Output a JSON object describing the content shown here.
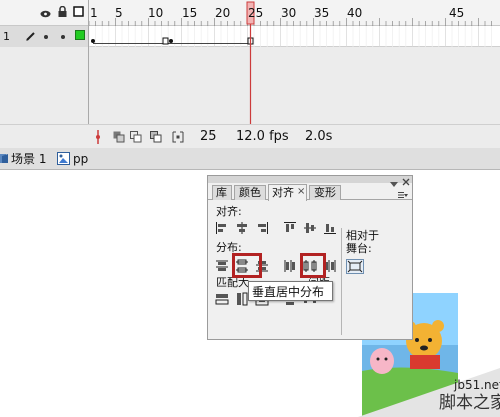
{
  "timeline": {
    "frame_numbers": [
      "1",
      "5",
      "10",
      "15",
      "20",
      "25",
      "30",
      "35",
      "40",
      "45"
    ],
    "layer_name": "1",
    "status": {
      "current_frame": "25",
      "frame_rate": "12.0 fps",
      "elapsed_time": "2.0s"
    }
  },
  "scene_bar": {
    "scene": "场景 1",
    "symbol": "pp"
  },
  "align_panel": {
    "tabs": [
      "库",
      "颜色",
      "对齐",
      "变形"
    ],
    "active_tab": "对齐",
    "tab_close": "×",
    "align_label": "对齐:",
    "distribute_label": "分布:",
    "match_size_label": "匹配大",
    "spacing_label_partial": "间距",
    "relative_to_label_1": "相对于",
    "relative_to_label_2": "舞台:",
    "tooltip": "垂直居中分布"
  },
  "watermark": {
    "site": "jb51.net",
    "name": "脚本之家"
  },
  "colors": {
    "playhead": "#cc3b3b",
    "highlight_box": "#b22222",
    "layer_swatch": "#22cc22"
  }
}
